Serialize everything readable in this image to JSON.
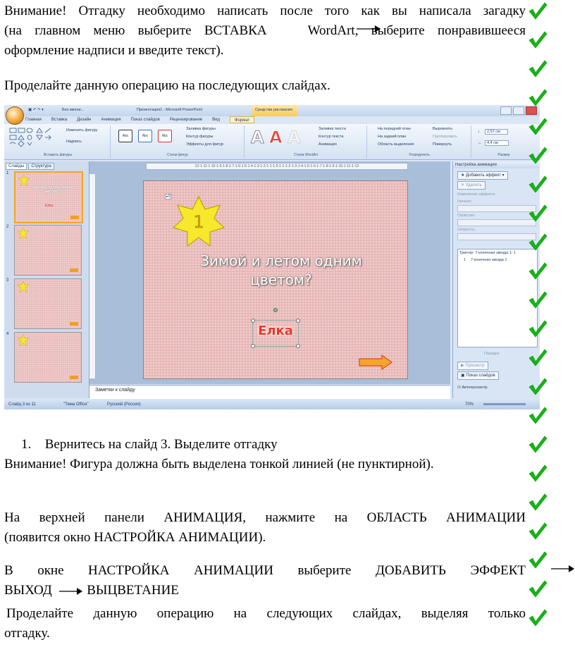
{
  "paragraphs": {
    "p1_line1": "Внимание! Отгадку необходимо написать после того как вы написала загадку",
    "p1_line2a": "(на главном меню выберите ВСТАВКА",
    "p1_line2b": "WordArt,",
    "p1_line2c": "выберите понравившееся",
    "p1_line3": "оформление надписи и введите текст).",
    "p2": "Проделайте данную операцию на последующих слайдах.",
    "list_number": "1.",
    "list_item": "Вернитесь на слайд 3. Выделите отгадку",
    "p3": "Внимание! Фигура должна быть выделена тонкой линией (не пунктирной).",
    "p4_line1": "На верхней панели АНИМАЦИЯ, нажмите на ОБЛАСТЬ АНИМАЦИИ",
    "p4_line2": "(появится окно НАСТРОЙКА АНИМАЦИИ).",
    "p5_line1": "В окне НАСТРОЙКА АНИМАЦИИ выберите ДОБАВИТЬ ЭФФЕКТ",
    "p5_line2a": "ВЫХОД",
    "p5_line2b": "ВЫЦВЕТАНИЕ",
    "p6_line1": "Проделайте данную операцию на следующих слайдах, выделяя только",
    "p6_line2": "отгадку."
  },
  "screenshot": {
    "window_title": "Презентация1 - Microsoft PowerPoint",
    "quick_file": "Без имени...",
    "context_tab": "Средства рисования",
    "tabs": [
      "Главная",
      "Вставка",
      "Дизайн",
      "Анимация",
      "Показ слайдов",
      "Рецензирование",
      "Вид",
      "Формат"
    ],
    "ribbon": {
      "insert_shapes_label": "Вставить фигуры",
      "change_shape": "Изменить фигуру",
      "text_box": "Надпись",
      "shape_styles_label": "Стили фигур",
      "abc": "Abc",
      "fill": "Заливка фигуры",
      "outline": "Контур фигуры",
      "effects": "Эффекты для фигур",
      "wordart_label": "Стили WordArt",
      "text_fill": "Заливка текста",
      "text_outline": "Контур текста",
      "animation": "Анимация",
      "arrange_label": "Упорядочить",
      "bring_front": "На передний план",
      "send_back": "На задний план",
      "selection_pane": "Область выделения",
      "align": "Выровнять",
      "group": "Группировать",
      "rotate": "Повернуть",
      "size_label": "Размер",
      "height": "2,57 см",
      "width": "4,4 см"
    },
    "left_tabs": [
      "Слайды",
      "Структура"
    ],
    "thumb1_title": "Зимой и летом одним цветом?",
    "thumb1_answer": "Елка",
    "thumb_numbers": [
      "1",
      "2",
      "3",
      "4"
    ],
    "ruler": "·12·1·11·1·10·1·9·1·8·1·7·1·6·1·5·1·4·1·3·1·2·1·1·1·0·1·1·1·2·1·3·1·4·1·5·1·6·1·7·1·8·1·9·1·10·1·11·1·12·",
    "slide_star_number": "1",
    "slide_title": "Зимой и летом одним цветом?",
    "slide_answer": "Елка",
    "notes": "Заметки к слайду",
    "taskpane": {
      "title": "Настройка анимации",
      "add_effect": "Добавить эффект",
      "remove": "Удалить",
      "change_effect": "Изменение эффекта",
      "start": "Начало:",
      "property": "Свойство:",
      "speed": "Скорость:",
      "trigger": "Триггер: 7-конечная звезда 1: 1",
      "item": "7-конечная звезда 1",
      "item_num": "1",
      "order": "Порядок",
      "preview": "Просмотр",
      "slideshow": "Показ слайдов",
      "autopreview": "Автопросмотр"
    },
    "status": {
      "slide": "Слайд 3 из 11",
      "theme": "\"Тема Office\"",
      "lang": "Русский (Россия)",
      "zoom": "70%"
    }
  },
  "colors": {
    "tick_green": "#12b812",
    "slide_pink": "#e7b7b7",
    "star_yellow": "#f6e82a",
    "answer_red": "#e8392b"
  }
}
